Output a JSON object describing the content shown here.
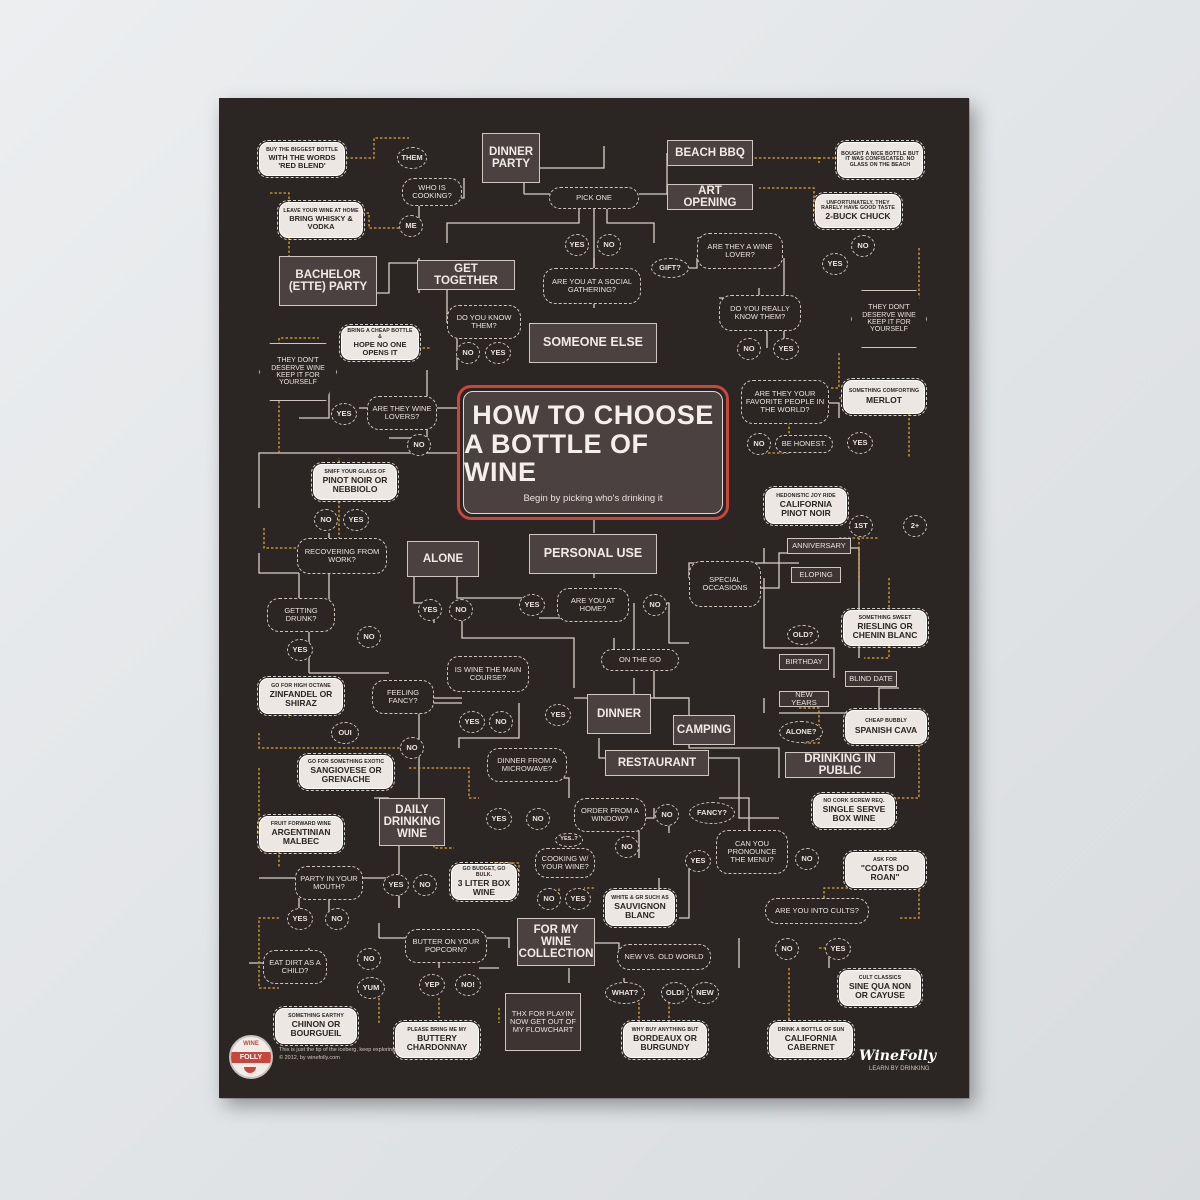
{
  "title": {
    "line1": "HOW TO CHOOSE",
    "line2": "A BOTTLE OF WINE",
    "subtitle": "Begin by picking who's drinking it"
  },
  "nodes": {
    "dinner_party": "DINNER PARTY",
    "beach_bbq": "BEACH BBQ",
    "art_opening": "ART OPENING",
    "pick_one": "PICK ONE",
    "them": "THEM",
    "me": "ME",
    "who_cooking": "WHO IS COOKING?",
    "bachelor": "BACHELOR (ETTE) PARTY",
    "get_together": "GET TOGETHER",
    "social_gathering": "ARE YOU AT A SOCIAL GATHERING?",
    "gift": "GIFT?",
    "wine_lover": "ARE THEY A WINE LOVER?",
    "know_them": "DO YOU KNOW THEM?",
    "really_know": "DO YOU REALLY KNOW THEM?",
    "someone_else": "SOMEONE ELSE",
    "favorite_people": "ARE THEY YOUR FAVORITE PEOPLE IN THE WORLD?",
    "be_honest": "BE HONEST.",
    "wine_lovers": "ARE THEY WINE LOVERS?",
    "personal_use": "PERSONAL USE",
    "alone": "ALONE",
    "recovering": "RECOVERING FROM WORK?",
    "at_home": "ARE YOU AT HOME?",
    "special": "SPECIAL OCCASIONS",
    "anniversary": "ANNIVERSARY",
    "eloping": "ELOPING",
    "old": "OLD?",
    "birthday": "BIRTHDAY",
    "blind_date": "BLIND DATE",
    "first": "1ST",
    "two_plus": "2+",
    "getting_drunk": "GETTING DRUNK?",
    "on_the_go": "ON THE GO",
    "main_course": "IS WINE THE MAIN COURSE?",
    "feeling_fancy": "FEELING FANCY?",
    "dinner": "DINNER",
    "camping": "CAMPING",
    "new_years": "NEW YEARS",
    "alone_q": "ALONE?",
    "restaurant": "RESTAURANT",
    "drinking_public": "DRINKING IN PUBLIC",
    "microwave": "DINNER FROM A MICROWAVE?",
    "oui": "OUI",
    "daily": "DAILY DRINKING WINE",
    "order_window": "ORDER FROM A WINDOW?",
    "fancy_q": "FANCY?",
    "yes7": "YES..?",
    "pronounce": "CAN YOU PRONOUNCE THE MENU?",
    "cooking_wine": "COOKING W/ YOUR WINE?",
    "party_mouth": "PARTY IN YOUR MOUTH?",
    "cults": "ARE YOU INTO CULTS?",
    "wine_collection": "FOR MY WINE COLLECTION",
    "popcorn": "BUTTER ON YOUR POPCORN?",
    "new_old": "NEW VS. OLD WORLD",
    "eat_dirt": "EAT DIRT AS A CHILD?",
    "yum": "YUM",
    "yep": "YEP",
    "no_bang": "NO!",
    "what": "WHAT?",
    "old_bang": "OLD!",
    "new": "NEW",
    "thx": "THX FOR PLAYIN' NOW GET OUT OF MY FLOWCHART",
    "yes": "YES",
    "no": "NO"
  },
  "side_notes": {
    "deserve_left": "THEY DON'T DESERVE WINE KEEP IT FOR YOURSELF",
    "deserve_right": "THEY DON'T DESERVE WINE KEEP IT FOR YOURSELF"
  },
  "recommendations": [
    {
      "note": "BUY THE BIGGEST BOTTLE",
      "wine": "WITH THE WORDS 'RED BLEND'"
    },
    {
      "note": "LEAVE YOUR WINE AT HOME",
      "wine": "BRING WHISKY & VODKA"
    },
    {
      "note": "BRING A CHEAP BOTTLE &",
      "wine": "HOPE NO ONE OPENS IT"
    },
    {
      "note": "BOUGHT A NICE BOTTLE BUT IT WAS CONFISCATED. NO GLASS ON THE BEACH",
      "wine": ""
    },
    {
      "note": "UNFORTUNATELY, THEY RARELY HAVE GOOD TASTE",
      "wine": "2-BUCK CHUCK"
    },
    {
      "note": "SOMETHING COMFORTING",
      "wine": "MERLOT"
    },
    {
      "note": "SNIFF YOUR GLASS OF",
      "wine": "PINOT NOIR or NEBBIOLO"
    },
    {
      "note": "HEDONISTIC JOY RIDE",
      "wine": "CALIFORNIA PINOT NOIR"
    },
    {
      "note": "SOMETHING SWEET",
      "wine": "RIESLING or CHENIN BLANC"
    },
    {
      "note": "GO FOR HIGH OCTANE",
      "wine": "ZINFANDEL or SHIRAZ"
    },
    {
      "note": "CHEAP BUBBLY",
      "wine": "SPANISH CAVA"
    },
    {
      "note": "GO FOR SOMETHING EXOTIC",
      "wine": "SANGIOVESE or GRENACHE"
    },
    {
      "note": "NO CORK SCREW REQ.",
      "wine": "SINGLE SERVE BOX WINE"
    },
    {
      "note": "FRUIT FORWARD WINE",
      "wine": "ARGENTINIAN MALBEC"
    },
    {
      "note": "ASK FOR",
      "wine": "\"COATS DO ROAN\""
    },
    {
      "note": "GO BUDGET, GO BULK.",
      "wine": "3 LITER BOX WINE"
    },
    {
      "note": "WHITE & GR SUCH AS",
      "wine": "SAUVIGNON BLANC"
    },
    {
      "note": "CULT CLASSICS",
      "wine": "SINE QUA NON or CAYUSE"
    },
    {
      "note": "SOMETHING EARTHY",
      "wine": "CHINON or BOURGUEIL"
    },
    {
      "note": "PLEASE BRING ME MY",
      "wine": "BUTTERY CHARDONNAY"
    },
    {
      "note": "WHY BUY ANYTHING BUT",
      "wine": "BORDEAUX or BURGUNDY"
    },
    {
      "note": "DRINK A BOTTLE OF SUN",
      "wine": "CALIFORNIA CABERNET"
    }
  ],
  "footer": {
    "badge_top": "WINE",
    "badge_band": "FOLLY",
    "footnote1": "This is just the tip of the iceberg, keep exploring!",
    "footnote2": "© 2012, by winefolly.com",
    "brand": "WineFolly",
    "tagline": "LEARN BY DRINKING"
  },
  "colors": {
    "poster": "#2b2523",
    "box": "#4a4140",
    "accent": "#c8463c",
    "connector_yellow": "#d9a531",
    "line": "#cfc6c0"
  }
}
